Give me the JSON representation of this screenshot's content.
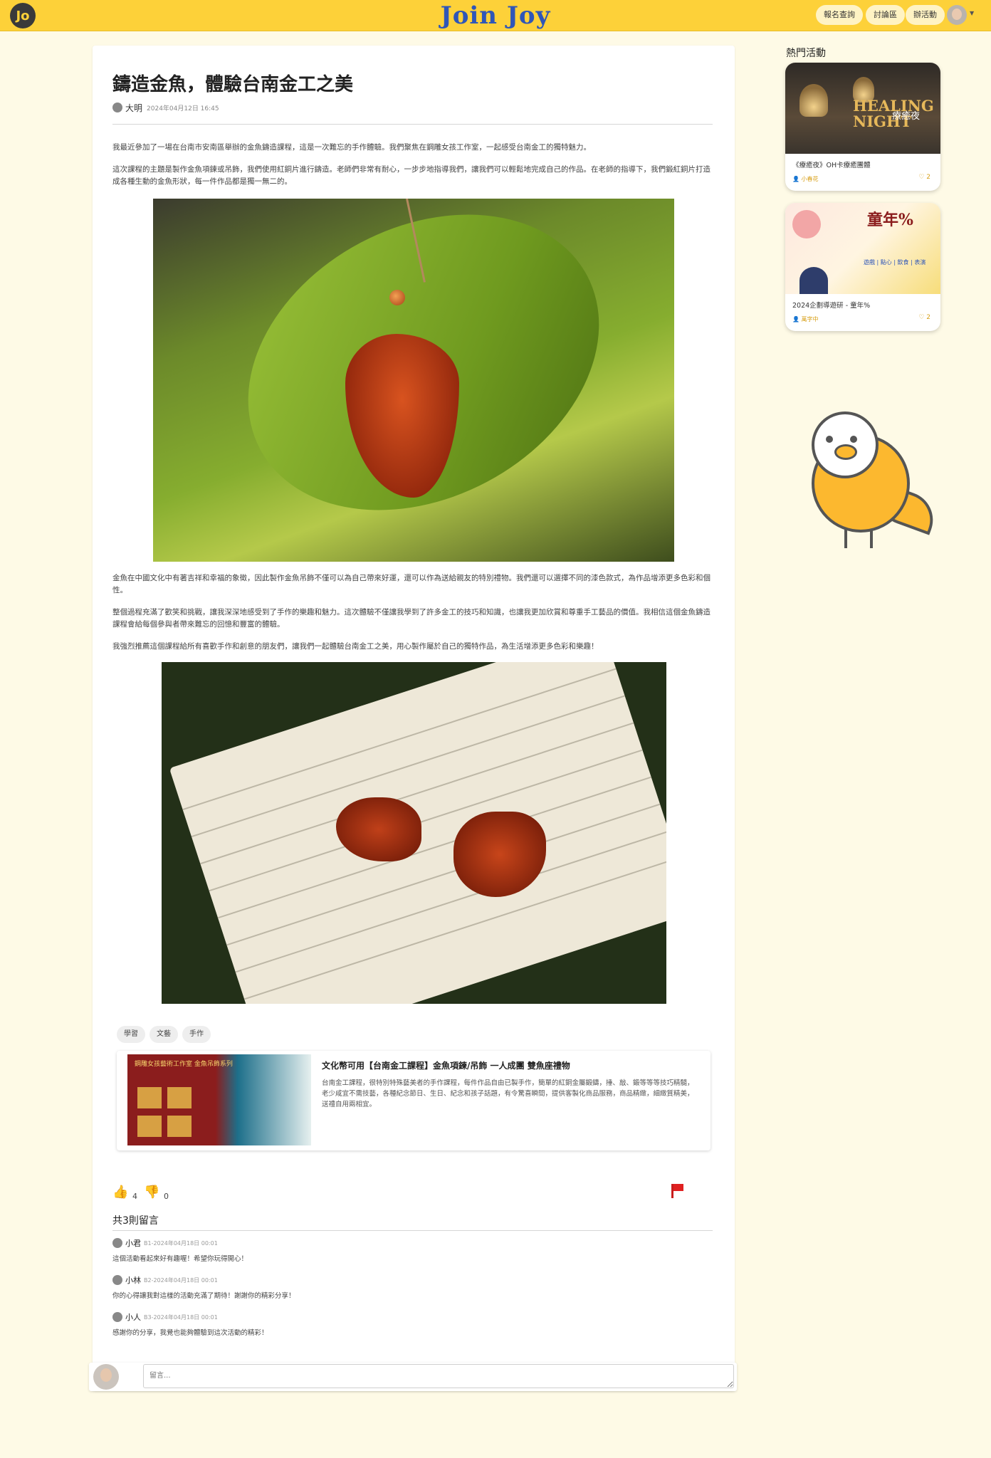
{
  "nav": {
    "brand": "Join Joy",
    "logo": "Jo",
    "buttons": [
      "報名查詢",
      "討論區",
      "辦活動"
    ]
  },
  "article": {
    "title": "鑄造金魚，體驗台南金工之美",
    "author": "大明",
    "date": "2024年04月12日 16:45",
    "paragraphs": [
      "我最近參加了一場在台南市安南區舉辦的金魚鑄造課程，這是一次難忘的手作體驗。我們聚焦在鋼雕女孩工作室，一起感受台南金工的獨特魅力。",
      "這次課程的主題是製作金魚項鍊或吊飾，我們使用紅銅片進行鑄造。老師們非常有耐心，一步步地指導我們，讓我們可以輕鬆地完成自己的作品。在老師的指導下，我們鍛紅銅片打造成各種生動的金魚形狀，每一件作品都是獨一無二的。",
      "金魚在中國文化中有著吉祥和幸福的象徵，因此製作金魚吊飾不僅可以為自己帶來好運，還可以作為送給親友的特別禮物。我們還可以選擇不同的漆色款式，為作品增添更多色彩和個性。",
      "整個過程充滿了歡笑和挑戰，讓我深深地感受到了手作的樂趣和魅力。這次體驗不僅讓我學到了許多金工的技巧和知識，也讓我更加欣賞和尊重手工藝品的價值。我相信這個金魚鑄造課程會給每個參與者帶來難忘的回憶和豐富的體驗。",
      "我強烈推薦這個課程給所有喜歡手作和創意的朋友們，讓我們一起體驗台南金工之美，用心製作屬於自己的獨特作品，為生活增添更多色彩和樂趣！"
    ],
    "tags": [
      "學習",
      "文藝",
      "手作"
    ],
    "link": {
      "title": "文化幣可用【台南金工課程】金魚項鍊/吊飾 一人成團 雙魚座禮物",
      "description": "台南金工課程，很特別特殊藝美者的手作課程，每件作品自由已製手作，簡單的紅銅金屬鍛鑄，捶、敲、鍛等等等技巧精髓，老少咸宜不需技藝，各種紀念節日、生日、紀念和孩子話題，有令驚喜瞬間，提供客製化商品服務，商品精緻，細緻質精美，送禮自用兩相宜。",
      "thumb_caption": "鋼雕女孩藝術工作室 金魚吊飾系列"
    },
    "likes": "4",
    "dislikes": "0"
  },
  "comments": {
    "heading": "共3則留言",
    "items": [
      {
        "name": "小君",
        "meta": "B1-2024年04月18日 00:01",
        "text": "這個活動看起來好有趣喔！希望你玩得開心！"
      },
      {
        "name": "小林",
        "meta": "B2-2024年04月18日 00:01",
        "text": "你的心得讓我對這樣的活動充滿了期待！謝謝你的精彩分享！"
      },
      {
        "name": "小人",
        "meta": "B3-2024年04月18日 00:01",
        "text": "感謝你的分享，我覺也能夠體驗到這次活動的精彩！"
      }
    ],
    "input_placeholder": "留言..."
  },
  "sidebar": {
    "title": "熱門活動",
    "events": [
      {
        "name": "《療癒夜》OH卡療癒團體",
        "host": "小春花",
        "likes": "2",
        "banner": "HEALING NIGHT",
        "banner_sub": "療癒夜"
      },
      {
        "name": "2024企劃導遊研 - 童年%",
        "host": "萬字中",
        "likes": "2",
        "banner": "童年%",
        "banner_sub": "遊戲 | 點心 | 飲食 | 表演"
      }
    ]
  },
  "colors": {
    "brand_yellow": "#fdd139",
    "brand_blue": "#2f56b8",
    "accent_gold": "#d8a019",
    "report_red": "#e02020"
  }
}
